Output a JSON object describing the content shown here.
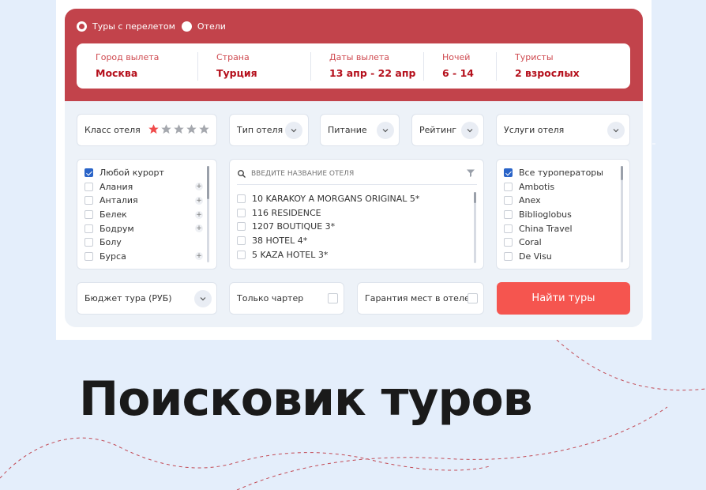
{
  "colors": {
    "background": "#e4eefb",
    "header_red": "#c2434b",
    "accent_text": "#b5101c",
    "button": "#f5554f",
    "check_blue": "#2a64c8",
    "star_active": "#f04b4b",
    "star_inactive": "#a5a8ae"
  },
  "tour_type": {
    "options": [
      {
        "label": "Туры с перелетом",
        "selected": true
      },
      {
        "label": "Отели",
        "selected": false
      }
    ]
  },
  "params": [
    {
      "title": "Город вылета",
      "value": "Москва"
    },
    {
      "title": "Страна",
      "value": "Турция"
    },
    {
      "title": "Даты вылета",
      "value": "13 апр - 22 апр"
    },
    {
      "title": "Ночей",
      "value": "6 - 14"
    },
    {
      "title": "Туристы",
      "value": "2 взрослых"
    }
  ],
  "filters": {
    "hotel_class": {
      "label": "Класс отеля",
      "stars_total": 5,
      "stars_selected": 1
    },
    "hotel_type": {
      "label": "Тип отеля",
      "icon": "chevron-down-icon"
    },
    "meals": {
      "label": "Питание",
      "icon": "chevron-down-icon"
    },
    "rating": {
      "label": "Рейтинг",
      "icon": "chevron-down-icon"
    },
    "services": {
      "label": "Услуги отеля",
      "icon": "chevron-down-icon"
    }
  },
  "resorts": [
    {
      "label": "Любой курорт",
      "checked": true,
      "expandable": false
    },
    {
      "label": "Алания",
      "checked": false,
      "expandable": true
    },
    {
      "label": "Анталия",
      "checked": false,
      "expandable": true
    },
    {
      "label": "Белек",
      "checked": false,
      "expandable": true
    },
    {
      "label": "Бодрум",
      "checked": false,
      "expandable": true
    },
    {
      "label": "Болу",
      "checked": false,
      "expandable": false
    },
    {
      "label": "Бурса",
      "checked": false,
      "expandable": true
    }
  ],
  "hotel_search": {
    "placeholder": "ВВЕДИТЕ НАЗВАНИЕ ОТЕЛЯ",
    "hotels": [
      "10 KARAKOY A MORGANS ORIGINAL 5*",
      "116 RESIDENCE",
      "1207 BOUTIQUE 3*",
      "38 HOTEL 4*",
      "5 KAZA HOTEL 3*"
    ]
  },
  "operators": [
    {
      "label": "Все туроператоры",
      "checked": true
    },
    {
      "label": "Ambotis",
      "checked": false
    },
    {
      "label": "Anex",
      "checked": false
    },
    {
      "label": "Biblioglobus",
      "checked": false
    },
    {
      "label": "China Travel",
      "checked": false
    },
    {
      "label": "Coral",
      "checked": false
    },
    {
      "label": "De Visu",
      "checked": false
    }
  ],
  "bottom": {
    "budget_label": "Бюджет тура (РУБ)",
    "charter_label": "Только чартер",
    "guarantee_label": "Гарантия мест в отеле",
    "search_button": "Найти туры"
  },
  "headline": "Поисковик туров"
}
